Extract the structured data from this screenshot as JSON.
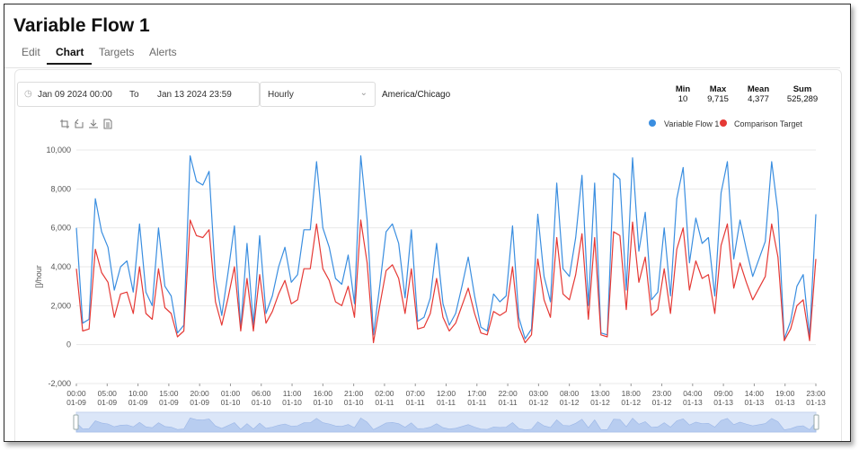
{
  "page": {
    "title": "Variable Flow 1"
  },
  "tabs": [
    {
      "label": "Edit"
    },
    {
      "label": "Chart"
    },
    {
      "label": "Targets"
    },
    {
      "label": "Alerts"
    }
  ],
  "controls": {
    "start": "Jan 09 2024 00:00",
    "to_label": "To",
    "end": "Jan 13 2024 23:59",
    "interval": "Hourly",
    "timezone": "America/Chicago"
  },
  "stats": [
    {
      "label": "Min",
      "value": "10"
    },
    {
      "label": "Max",
      "value": "9,715"
    },
    {
      "label": "Mean",
      "value": "4,377"
    },
    {
      "label": "Sum",
      "value": "525,289"
    }
  ],
  "icons": [
    "zoom-icon",
    "zoom-reset-icon",
    "download-icon",
    "data-view-icon"
  ],
  "colors": {
    "series1": "#3a8ee0",
    "series2": "#e53935",
    "grid": "#e8e8e8"
  },
  "chart_data": {
    "type": "line",
    "ylabel": "[]/hour",
    "ylim": [
      -2000,
      10000
    ],
    "yticks": [
      "10,000",
      "8,000",
      "6,000",
      "4,000",
      "2,000",
      "0",
      "-2,000"
    ],
    "legend_position": "top-right",
    "x_ticks": [
      [
        "00:00",
        "01-09"
      ],
      [
        "05:00",
        "01-09"
      ],
      [
        "10:00",
        "01-09"
      ],
      [
        "15:00",
        "01-09"
      ],
      [
        "20:00",
        "01-09"
      ],
      [
        "01:00",
        "01-10"
      ],
      [
        "06:00",
        "01-10"
      ],
      [
        "11:00",
        "01-10"
      ],
      [
        "16:00",
        "01-10"
      ],
      [
        "21:00",
        "01-10"
      ],
      [
        "02:00",
        "01-11"
      ],
      [
        "07:00",
        "01-11"
      ],
      [
        "12:00",
        "01-11"
      ],
      [
        "17:00",
        "01-11"
      ],
      [
        "22:00",
        "01-11"
      ],
      [
        "03:00",
        "01-12"
      ],
      [
        "08:00",
        "01-12"
      ],
      [
        "13:00",
        "01-12"
      ],
      [
        "18:00",
        "01-12"
      ],
      [
        "23:00",
        "01-12"
      ],
      [
        "04:00",
        "01-13"
      ],
      [
        "09:00",
        "01-13"
      ],
      [
        "14:00",
        "01-13"
      ],
      [
        "19:00",
        "01-13"
      ],
      [
        "23:00",
        "01-13"
      ]
    ],
    "series": [
      {
        "name": "Variable Flow 1",
        "values": [
          6000,
          1100,
          1300,
          7500,
          5800,
          5000,
          2800,
          4000,
          4300,
          2700,
          6200,
          2700,
          2000,
          6000,
          3000,
          2500,
          600,
          1000,
          9700,
          8400,
          8200,
          8900,
          3400,
          1500,
          3700,
          6100,
          800,
          5200,
          1000,
          5600,
          1600,
          2500,
          4000,
          5000,
          3200,
          3600,
          5900,
          5900,
          9400,
          6000,
          5000,
          3400,
          3100,
          4600,
          2100,
          9700,
          6400,
          500,
          3000,
          5800,
          6200,
          5200,
          2400,
          5900,
          1200,
          1400,
          2400,
          5200,
          2100,
          1000,
          1600,
          3000,
          4500,
          2500,
          900,
          700,
          2600,
          2200,
          2500,
          6100,
          1400,
          300,
          800,
          6700,
          3500,
          2200,
          8300,
          3900,
          3500,
          5500,
          8700,
          2000,
          8300,
          600,
          500,
          8800,
          8500,
          2800,
          9600,
          4800,
          6800,
          2300,
          2700,
          6000,
          2500,
          7500,
          9100,
          4200,
          6500,
          5200,
          5500,
          2500,
          7800,
          9400,
          4400,
          6400,
          4900,
          3500,
          4400,
          5300,
          9400,
          6800,
          300,
          1200,
          3000,
          3600,
          400,
          6700
        ]
      },
      {
        "name": "Comparison Target",
        "values": [
          3900,
          700,
          800,
          4900,
          3700,
          3200,
          1400,
          2600,
          2700,
          1600,
          4000,
          1600,
          1300,
          3900,
          1900,
          1600,
          400,
          700,
          6400,
          5600,
          5500,
          5900,
          2200,
          1000,
          2400,
          4000,
          700,
          3400,
          700,
          3600,
          1100,
          1700,
          2600,
          3300,
          2100,
          2300,
          3900,
          3900,
          6200,
          3900,
          3300,
          2200,
          2000,
          3000,
          1400,
          6400,
          4200,
          100,
          2000,
          3800,
          4100,
          3400,
          1600,
          3900,
          800,
          900,
          1600,
          3400,
          1400,
          700,
          1100,
          2000,
          2900,
          1600,
          600,
          500,
          1700,
          1500,
          1700,
          4000,
          900,
          100,
          500,
          4400,
          2300,
          1400,
          5500,
          2600,
          2300,
          3600,
          5700,
          1300,
          5500,
          500,
          400,
          5800,
          5600,
          1800,
          6300,
          3200,
          4500,
          1500,
          1800,
          3900,
          1600,
          4900,
          6000,
          2800,
          4300,
          3400,
          3600,
          1600,
          5100,
          6200,
          2900,
          4200,
          3200,
          2300,
          2900,
          3500,
          6200,
          4500,
          200,
          800,
          2000,
          2300,
          200,
          4400
        ]
      }
    ]
  }
}
